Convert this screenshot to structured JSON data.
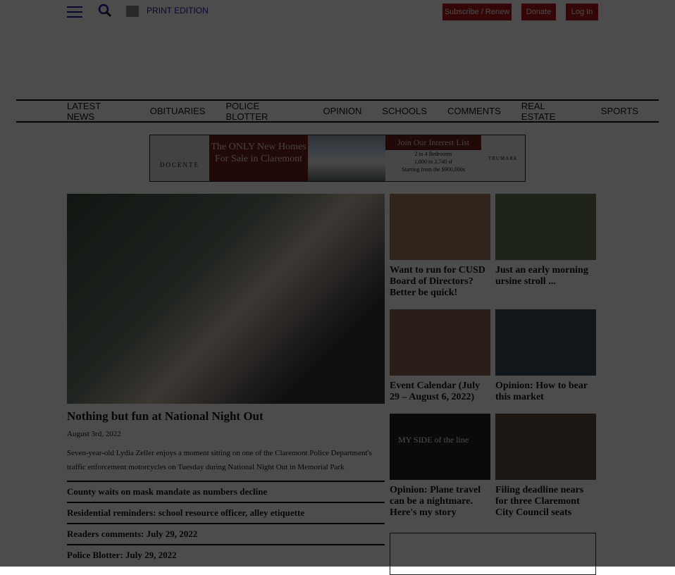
{
  "header": {
    "print_edition": "PRINT EDITION",
    "subscribe": "Subscribe / Renew",
    "donate": "Donate",
    "login": "Log In"
  },
  "nav": [
    "LATEST NEWS",
    "OBITUARIES",
    "POLICE BLOTTER",
    "OPINION",
    "SCHOOLS",
    "COMMENTS",
    "REAL ESTATE",
    "SPORTS"
  ],
  "ad": {
    "logo": "DOCENTE",
    "headline": "The ONLY New Homes For Sale in Claremont",
    "cta": "Join Our Interest List",
    "details": [
      "2 to 4 Bedrooms",
      "1,800 to 2,740 sf",
      "Starting from the $900,000s"
    ],
    "brand": "TRUMARK"
  },
  "main": {
    "title": "Nothing but fun at National Night Out",
    "date": "August 3rd, 2022",
    "description": "Seven-year-old Lydia Zeller enjoys a moment sitting on one of the Claremont Police Department's traffic enforcement motorcycles on Tuesday during National Night Out in Memorial Park"
  },
  "links": [
    "County waits on mask mandate as numbers decline",
    "Residential reminders: school resource officer, alley etiquette",
    "Readers comments: July 29, 2022",
    "Police Blotter: July 29, 2022"
  ],
  "cards": [
    {
      "title": "Want to run for CUSD Board of Directors? Better be quick!",
      "color": "#a07a60"
    },
    {
      "title": "Just an early morning ursine stroll ...",
      "color": "#6a7a5a"
    },
    {
      "title": "Event Calendar (July 29 – August 6, 2022)",
      "color": "#8a6a50"
    },
    {
      "title": "Opinion: How to bear this market",
      "color": "#3a4a5a"
    },
    {
      "title": "Opinion: Plane travel can be a nightmare. Here's my story",
      "color": "#2a2020",
      "overlay": "MY SIDE of the line"
    },
    {
      "title": "Filing deadline nears for three Claremont City Council seats",
      "color": "#5a4a3a"
    }
  ]
}
